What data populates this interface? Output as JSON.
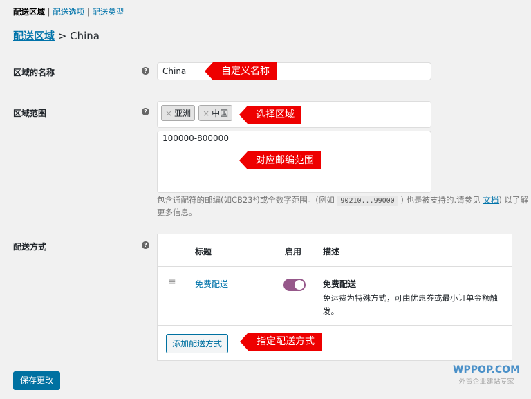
{
  "subnav": {
    "current": "配送区域",
    "items": [
      "配送选项",
      "配送类型"
    ]
  },
  "breadcrumb": {
    "link": "配送区域",
    "separator": ">",
    "current": "China"
  },
  "zone_name": {
    "label": "区域的名称",
    "value": "China",
    "callout": "自定义名称"
  },
  "zone_regions": {
    "label": "区域范围",
    "tags": [
      "亚洲",
      "中国"
    ],
    "callout": "选择区域",
    "postcodes": "100000-800000",
    "postcodes_callout": "对应邮编范围",
    "help_text_1": "包含通配符的邮编(如CB23*)或全数字范围。(例如",
    "help_code": "90210...99000",
    "help_text_2": ") 也是被支持的.请参见",
    "help_link": "文档",
    "help_text_3": ") 以了解更多信息。"
  },
  "shipping_methods": {
    "label": "配送方式",
    "headers": {
      "title": "标题",
      "enabled": "启用",
      "description": "描述"
    },
    "rows": [
      {
        "title": "免费配送",
        "enabled": true,
        "desc_title": "免费配送",
        "desc": "免运费为特殊方式，可由优惠券或最小订单金额触发。"
      }
    ],
    "add_button": "添加配送方式",
    "callout": "指定配送方式"
  },
  "save_button": "保存更改",
  "watermark": {
    "brand": "WPPOP.COM",
    "tagline": "外贸企业建站专家"
  },
  "colors": {
    "accent": "#0073aa",
    "toggle": "#96588a",
    "callout": "#ee0000"
  }
}
